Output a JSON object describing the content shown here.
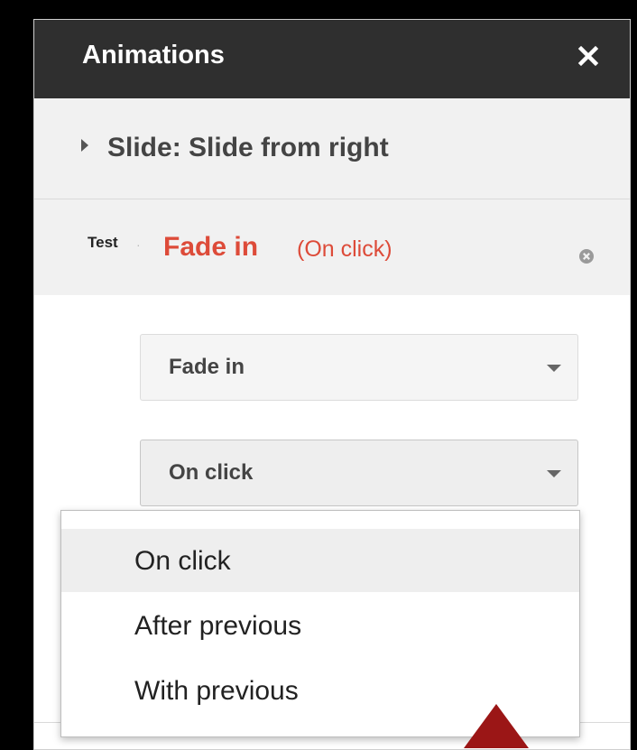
{
  "panel": {
    "title": "Animations",
    "close_icon": "close-icon"
  },
  "slide_transition": {
    "label": "Slide: Slide from right",
    "expand_icon": "triangle-right-icon"
  },
  "animation_item": {
    "target": "Test",
    "separator": "·",
    "effect": "Fade in",
    "trigger": "(On click)",
    "remove_icon": "remove-circle-icon",
    "accent_color": "#dd4b39"
  },
  "effect_select": {
    "value": "Fade in",
    "icon": "caret-down-icon"
  },
  "trigger_select": {
    "value": "On click",
    "icon": "caret-down-icon",
    "options": [
      {
        "label": "On click",
        "selected": true
      },
      {
        "label": "After previous",
        "selected": false
      },
      {
        "label": "With previous",
        "selected": false
      }
    ]
  },
  "annotation": {
    "pointer_icon": "triangle-up-pointer-icon",
    "color": "#9b1616"
  }
}
